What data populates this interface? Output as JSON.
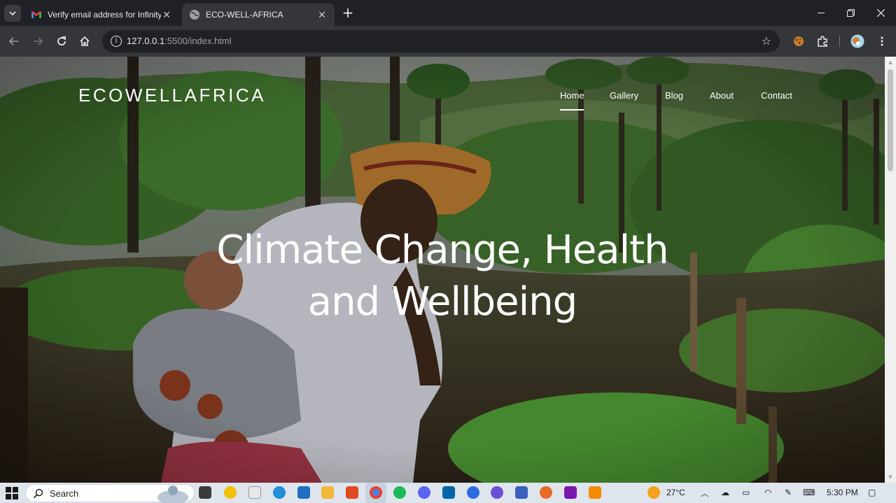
{
  "browser": {
    "tabs": [
      {
        "title": "Verify email address for Infinityf",
        "active": false,
        "favicon": "gmail-icon"
      },
      {
        "title": "ECO-WELL-AFRICA",
        "active": true,
        "favicon": "globe-icon"
      }
    ],
    "url_host": "127.0.0.1",
    "url_rest": ":5500/index.html"
  },
  "site": {
    "brand": "ECOWELLAFRICA",
    "nav": [
      "Home",
      "Gallery",
      "Blog",
      "About",
      "Contact"
    ],
    "active_nav": "Home",
    "headline_line1": "Climate Change, Health",
    "headline_line2": "and Wellbeing"
  },
  "taskbar": {
    "search_label": "Search",
    "weather": "27°C",
    "time": "5:30 PM"
  },
  "colors": {
    "chrome_dark": "#202124",
    "chrome_toolbar": "#35363a",
    "taskbar": "#dfe5ed",
    "hero_text": "#ffffff"
  }
}
